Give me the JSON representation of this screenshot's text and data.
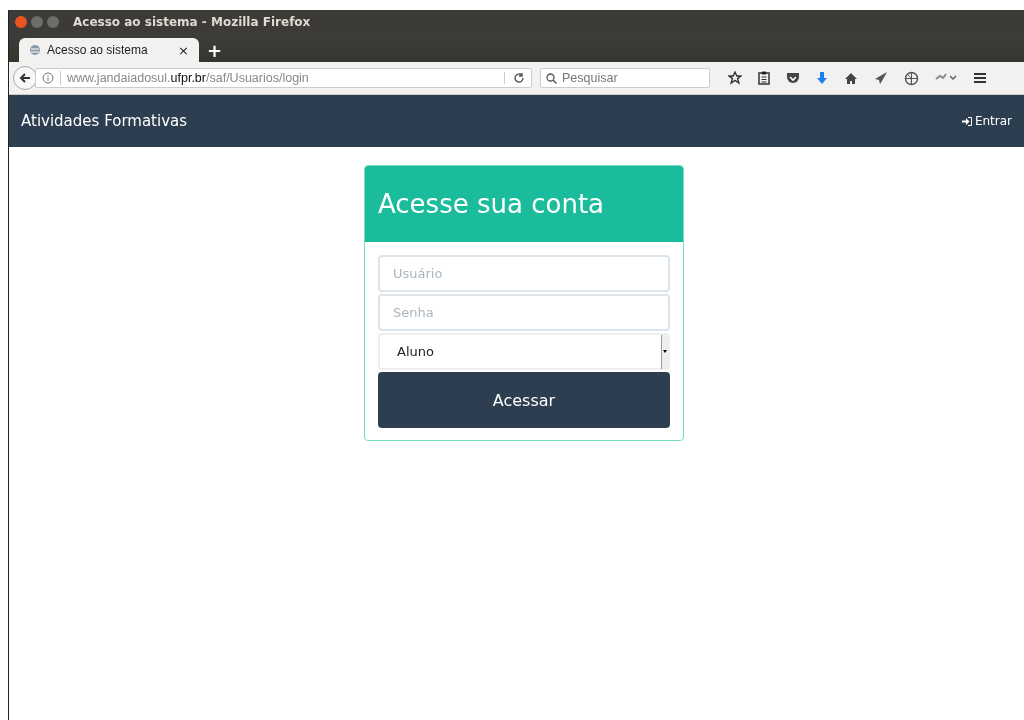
{
  "window": {
    "title": "Acesso ao sistema - Mozilla Firefox"
  },
  "tabs": [
    {
      "label": "Acesso ao sistema",
      "selected": true,
      "close": "×"
    }
  ],
  "new_tab": "+",
  "address_bar": {
    "url": "www.jandaiadosul.**ufpr.br**/saf/Usuarios/login"
  },
  "search": {
    "placeholder": "Pesquisar"
  },
  "navbar": {
    "brand": "Atividades Formativas",
    "login_link": "Entrar"
  },
  "login_card": {
    "title": "Acesse sua conta",
    "fields": [
      {
        "kind": "text",
        "placeholder": "Usuário"
      },
      {
        "kind": "password",
        "placeholder": "Senha"
      },
      {
        "kind": "select",
        "value": "Aluno"
      }
    ],
    "submit": "Acessar"
  }
}
